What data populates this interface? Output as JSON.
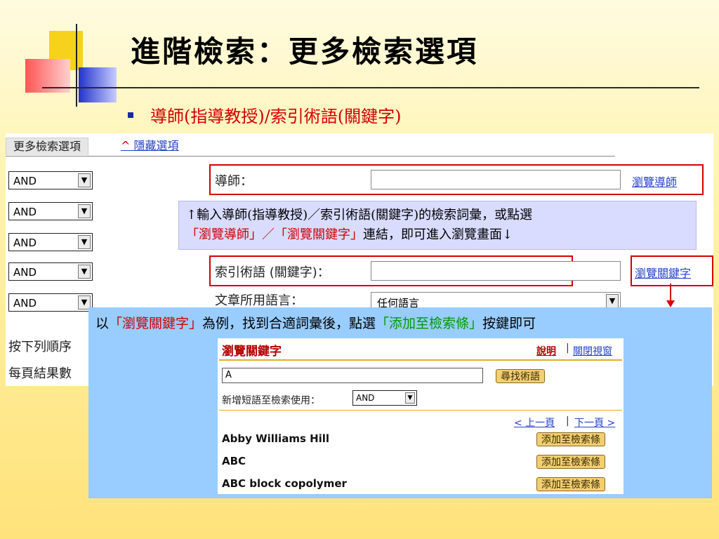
{
  "slide": {
    "title": "進階檢索：更多檢索選項",
    "bullet": "導師(指導教授)/索引術語(關鍵字)"
  },
  "panel": {
    "tab_label": "更多檢索選項",
    "hide_link": "隱藏選項",
    "operators": [
      "AND",
      "AND",
      "AND",
      "AND",
      "AND"
    ],
    "advisor_label": "導師：",
    "browse_advisor": "瀏覽導師",
    "keyword_label": "索引術語 (關鍵字)：",
    "browse_keyword": "瀏覽關鍵字",
    "language_label": "文章所用語言：",
    "language_value": "任何語言",
    "sort_label": "按下列順序",
    "per_page_label": "每頁結果數"
  },
  "callout": {
    "line1": "↑輸入導師(指導教授)／索引術語(關鍵字)的檢索詞彙，或點選",
    "red_text": "「瀏覽導師」／「瀏覽關鍵字」",
    "line2_rest": "連結，即可進入瀏覽畫面↓"
  },
  "blue_caption": {
    "prefix": "以",
    "highlight1": "「瀏覽關鍵字」",
    "middle": "為例，找到合適詞彙後，點選",
    "highlight2": "「添加至檢索條」",
    "suffix": "按鍵即可"
  },
  "popup": {
    "title": "瀏覽關鍵字",
    "help": "說明",
    "separator": "|",
    "close": "關閉視窗",
    "search_value": "A",
    "find_button": "尋找術語",
    "add_label": "新增短語至檢索使用：",
    "operator": "AND",
    "prev": "< 上一頁",
    "next": "下一頁 >",
    "terms": [
      {
        "label": "Abby Williams Hill",
        "button": "添加至檢索條"
      },
      {
        "label": "ABC",
        "button": "添加至檢索條"
      },
      {
        "label": "ABC block copolymer",
        "button": "添加至檢索條"
      }
    ]
  },
  "colors": {
    "accent_red": "#d00000",
    "link_blue": "#2340c8",
    "popup_bg": "#99ccff",
    "callout_bg": "#d9dcff",
    "button_gold": "#f3cf73"
  }
}
